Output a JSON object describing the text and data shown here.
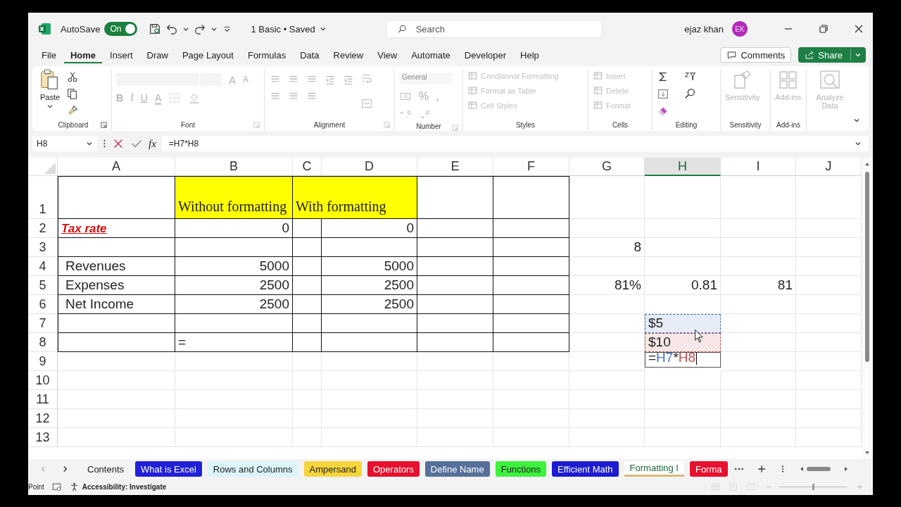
{
  "title_bar": {
    "autosave_label": "AutoSave",
    "autosave": {
      "on": true,
      "text": "On"
    },
    "document": "1 Basic • Saved",
    "search": {
      "placeholder": "Search"
    },
    "user": "ejaz khan",
    "avatar": "EK"
  },
  "menu": {
    "tabs": [
      {
        "label": "File",
        "selected": false
      },
      {
        "label": "Home",
        "selected": true
      },
      {
        "label": "Insert",
        "selected": false
      },
      {
        "label": "Draw",
        "selected": false
      },
      {
        "label": "Page Layout",
        "selected": false
      },
      {
        "label": "Formulas",
        "selected": false
      },
      {
        "label": "Data",
        "selected": false
      },
      {
        "label": "Review",
        "selected": false
      },
      {
        "label": "View",
        "selected": false
      },
      {
        "label": "Automate",
        "selected": false
      },
      {
        "label": "Developer",
        "selected": false
      },
      {
        "label": "Help",
        "selected": false
      }
    ],
    "comments": "Comments",
    "share": "Share"
  },
  "ribbon": {
    "groups": [
      {
        "kind": "clipboard",
        "label": "Clipboard",
        "launcher": true,
        "button": "Paste"
      },
      {
        "kind": "font",
        "label": "Font",
        "launcher": true,
        "letters": [
          {
            "kind": "grow",
            "text": "A"
          },
          {
            "kind": "shrink",
            "text": "A"
          },
          {
            "kind": "bold",
            "text": "B"
          },
          {
            "kind": "italic",
            "text": "I"
          },
          {
            "kind": "underline",
            "text": "U"
          },
          {
            "kind": "color",
            "text": "A"
          }
        ]
      },
      {
        "kind": "alignment",
        "label": "Alignment",
        "launcher": true
      },
      {
        "kind": "number",
        "label": "Number",
        "launcher": true,
        "format": "General",
        "symbols": [
          "%",
          ","
        ]
      },
      {
        "kind": "styles",
        "label": "Styles",
        "launcher": false,
        "commands": [
          {
            "text": "Conditional Formatting",
            "disabled": true
          },
          {
            "text": "Format as Table",
            "disabled": true
          },
          {
            "text": "Cell Styles",
            "disabled": true
          }
        ]
      },
      {
        "kind": "cells",
        "label": "Cells",
        "launcher": false,
        "commands": [
          {
            "text": "Insert",
            "disabled": true
          },
          {
            "text": "Delete",
            "disabled": true
          },
          {
            "text": "Format",
            "disabled": true
          }
        ]
      },
      {
        "kind": "editing",
        "label": "Editing",
        "launcher": false
      },
      {
        "kind": "sensitivity",
        "label": "Sensitivity",
        "launcher": false,
        "button": "Sensitivity",
        "disabled": true
      },
      {
        "kind": "addins",
        "label": "Add-ins",
        "launcher": false,
        "button": "Add-ins",
        "disabled": true
      },
      {
        "kind": "analyze",
        "launcher": false,
        "button": "Analyze Data",
        "disabled": true
      }
    ]
  },
  "formula_bar": {
    "name_box": "H8",
    "function_label": "fx",
    "formula": "=H7*H8"
  },
  "sheet": {
    "columns": [
      {
        "label": "A",
        "selected": false
      },
      {
        "label": "B",
        "selected": false
      },
      {
        "label": "C",
        "selected": false
      },
      {
        "label": "D",
        "selected": false
      },
      {
        "label": "E",
        "selected": false
      },
      {
        "label": "F",
        "selected": false
      },
      {
        "label": "G",
        "selected": false
      },
      {
        "label": "H",
        "selected": true
      },
      {
        "label": "I",
        "selected": false
      },
      {
        "label": "J",
        "selected": false
      }
    ],
    "rows": [
      {
        "number": "1",
        "bordered": true,
        "cells": {
          "B": {
            "kind": "heading",
            "text": "Without formatting"
          },
          "C": {
            "merged": true,
            "kind": "heading",
            "text": "With formatting"
          }
        }
      },
      {
        "number": "2",
        "bordered": true,
        "cells": {
          "A": {
            "kind": "alert",
            "text": "Tax rate"
          },
          "B": {
            "kind": "number",
            "text": "0"
          },
          "D": {
            "kind": "number",
            "text": "0"
          }
        }
      },
      {
        "number": "3",
        "bordered": true,
        "cells": {
          "G": {
            "kind": "number",
            "text": "8"
          }
        }
      },
      {
        "number": "4",
        "bordered": true,
        "cells": {
          "A": {
            "kind": "label",
            "text": "Revenues"
          },
          "B": {
            "kind": "number",
            "text": "5000"
          },
          "D": {
            "kind": "number",
            "text": "5000"
          }
        }
      },
      {
        "number": "5",
        "bordered": true,
        "cells": {
          "A": {
            "kind": "label",
            "text": "Expenses"
          },
          "B": {
            "kind": "number",
            "text": "2500"
          },
          "D": {
            "kind": "number",
            "text": "2500"
          },
          "G": {
            "kind": "number",
            "text": "81%"
          },
          "H": {
            "kind": "number",
            "text": "0.81"
          },
          "I": {
            "kind": "number",
            "text": "81"
          }
        }
      },
      {
        "number": "6",
        "bordered": true,
        "cells": {
          "A": {
            "kind": "label",
            "text": "Net Income"
          },
          "B": {
            "kind": "number",
            "text": "2500"
          },
          "D": {
            "kind": "number",
            "text": "2500"
          }
        }
      },
      {
        "number": "7",
        "bordered": true,
        "cells": {
          "H": {
            "kind": "reference",
            "color": "#4472c4",
            "text": "$5"
          }
        }
      },
      {
        "number": "8",
        "bordered": true,
        "cells": {
          "B": {
            "kind": "text",
            "text": "="
          },
          "H": {
            "kind": "reference",
            "color": "#c0504d",
            "text": "$10"
          }
        }
      },
      {
        "number": "9",
        "bordered": false,
        "cells": {
          "H": {
            "kind": "formula",
            "parts": [
              {
                "text": "=",
                "color": "#222222"
              },
              {
                "text": "H7",
                "color": "#4472c4"
              },
              {
                "text": "*",
                "color": "#222222"
              },
              {
                "text": "H8",
                "color": "#c0504d"
              }
            ]
          }
        }
      },
      {
        "number": "10",
        "bordered": false
      },
      {
        "number": "11",
        "bordered": false
      },
      {
        "number": "12",
        "bordered": false
      },
      {
        "number": "13",
        "bordered": false
      }
    ]
  },
  "sheet_tabs": [
    {
      "label": "Contents",
      "selected": false
    },
    {
      "label": "What is Excel",
      "color": "#2121d8",
      "selected": false
    },
    {
      "label": "Rows and Columns",
      "color": "#dcf5fa",
      "selected": false
    },
    {
      "label": "Ampersand",
      "color": "#f6d53c",
      "selected": false
    },
    {
      "label": "Operators",
      "color": "#e5112e",
      "selected": false
    },
    {
      "label": "Define Name",
      "color": "#56709a",
      "selected": false
    },
    {
      "label": "Functions",
      "color": "#3df23d",
      "selected": false
    },
    {
      "label": "Efficient Math",
      "color": "#1c1cd0",
      "selected": false
    },
    {
      "label": "Formatting I",
      "color": "#d8b97a",
      "selected": true
    },
    {
      "label": "Forma",
      "color": "#e5112e",
      "selected": false
    }
  ],
  "status_bar": {
    "mode": "Point",
    "accessibility": "Accessibility: Investigate",
    "zoom": {
      "level": 0.5
    }
  }
}
